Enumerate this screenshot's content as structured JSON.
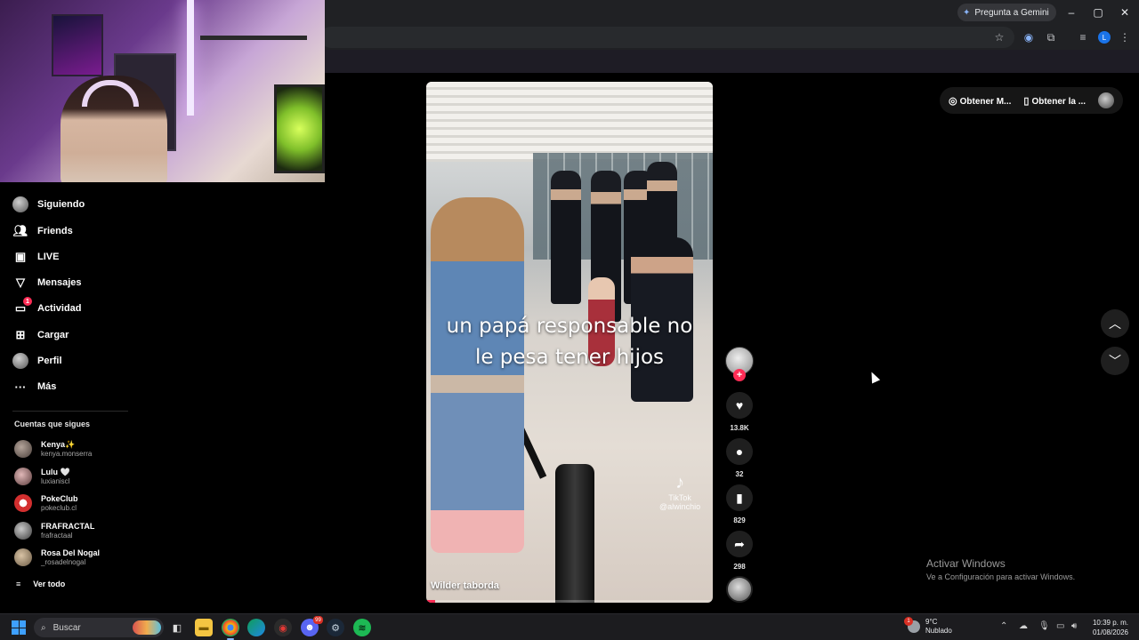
{
  "browser": {
    "gemini_label": "Pregunta a Gemini",
    "profile_initial": "L",
    "window_controls": [
      "–",
      "▢",
      "✕"
    ]
  },
  "sidebar": {
    "items": [
      {
        "label": "Siguiendo",
        "icon": "following-avatar"
      },
      {
        "label": "Friends",
        "icon": "friends-icon"
      },
      {
        "label": "LIVE",
        "icon": "live-icon"
      },
      {
        "label": "Mensajes",
        "icon": "messages-icon"
      },
      {
        "label": "Actividad",
        "icon": "activity-icon",
        "badge": "1"
      },
      {
        "label": "Cargar",
        "icon": "upload-icon"
      },
      {
        "label": "Perfil",
        "icon": "profile-avatar"
      },
      {
        "label": "Más",
        "icon": "more-icon"
      }
    ],
    "following_title": "Cuentas que sigues",
    "accounts": [
      {
        "name": "Kenya✨",
        "handle": "kenya.monserra"
      },
      {
        "name": "Lulu 🤍",
        "handle": "luxianiscl"
      },
      {
        "name": "PokeClub",
        "handle": "pokeclub.cl"
      },
      {
        "name": "FRAFRACTAL",
        "handle": "frafractaal"
      },
      {
        "name": "Rosa Del Nogal",
        "handle": "_rosadelnogal"
      }
    ],
    "see_all": "Ver todo"
  },
  "video": {
    "caption_line1": "un papá responsable no",
    "caption_line2": "le pesa tener hijos",
    "watermark_brand": "TikTok",
    "watermark_handle": "@alwinchio",
    "author": "Wilder taborda",
    "progress": 0.03,
    "likes": "13.8K",
    "comments": "32",
    "saves": "829",
    "shares": "298"
  },
  "top_right": {
    "get_coins": "Obtener M...",
    "get_app": "Obtener la ..."
  },
  "watermark": {
    "title": "Activar Windows",
    "subtitle": "Ve a Configuración para activar Windows."
  },
  "taskbar": {
    "search_placeholder": "Buscar",
    "weather_temp": "9°C",
    "weather_desc": "Nublado",
    "weather_badge": "1",
    "discord_badge": "99",
    "time": "10:39 p. m.",
    "date": "01/08/2026"
  }
}
